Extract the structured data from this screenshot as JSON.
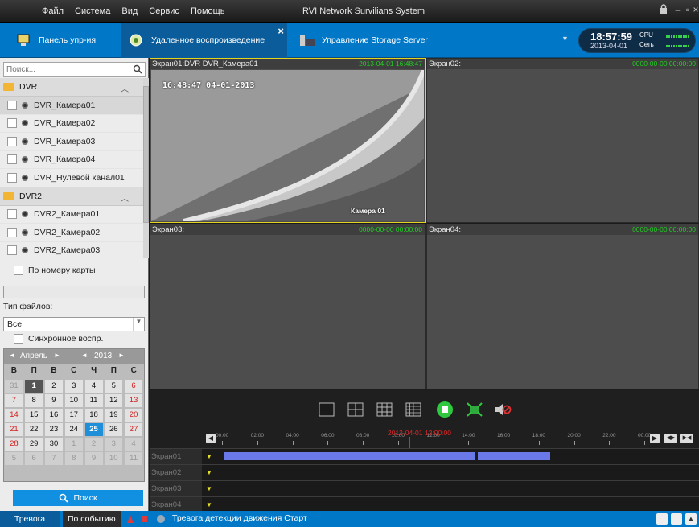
{
  "menu": [
    "Файл",
    "Система",
    "Вид",
    "Сервис",
    "Помощь"
  ],
  "app_title": "RVI Network Survilians System",
  "tabs": [
    {
      "label": "Панель упр-ия",
      "icon": "monitor-icon"
    },
    {
      "label": "Удаленное воспроизведение",
      "icon": "playback-icon",
      "active": true
    },
    {
      "label": "Управление Storage Server",
      "icon": "storage-server-icon"
    }
  ],
  "clock": {
    "time": "18:57:59",
    "date": "2013-04-01",
    "cpu_label": "CPU",
    "net_label": "Сеть"
  },
  "search": {
    "placeholder": "Поиск..."
  },
  "tree": {
    "groups": [
      {
        "name": "DVR",
        "items": [
          "DVR_Камера01",
          "DVR_Камера02",
          "DVR_Камера03",
          "DVR_Камера04",
          "DVR_Нулевой канал01"
        ]
      },
      {
        "name": "DVR2",
        "items": [
          "DVR2_Камера01",
          "DVR2_Камера02",
          "DVR2_Камера03"
        ]
      }
    ]
  },
  "by_card": "По номеру карты",
  "file_type_label": "Тип файлов:",
  "file_type_value": "Все",
  "sync_label": "Синхронное воспр.",
  "calendar": {
    "month_label": "Апрель",
    "year_label": "2013",
    "prev": "◄",
    "next": "►",
    "dow": [
      "В",
      "П",
      "В",
      "С",
      "Ч",
      "П",
      "С"
    ],
    "weeks": [
      [
        "31",
        "1",
        "2",
        "3",
        "4",
        "5",
        "6"
      ],
      [
        "7",
        "8",
        "9",
        "10",
        "11",
        "12",
        "13"
      ],
      [
        "14",
        "15",
        "16",
        "17",
        "18",
        "19",
        "20"
      ],
      [
        "21",
        "22",
        "23",
        "24",
        "25",
        "26",
        "27"
      ],
      [
        "28",
        "29",
        "30",
        "1",
        "2",
        "3",
        "4"
      ],
      [
        "5",
        "6",
        "7",
        "8",
        "9",
        "10",
        "11"
      ]
    ],
    "today": "1",
    "selected": "25"
  },
  "search_button": "Поиск",
  "panes": [
    {
      "title": "Экран01:DVR DVR_Камера01",
      "timestamp": "2013-04-01 16:48:47"
    },
    {
      "title": "Экран02:",
      "timestamp": "0000-00-00 00:00:00"
    },
    {
      "title": "Экран03:",
      "timestamp": "0000-00-00 00:00:00"
    },
    {
      "title": "Экран04:",
      "timestamp": "0000-00-00 00:00:00"
    }
  ],
  "osd": {
    "datetime": "16:48:47 04-01-2013",
    "camera": "Камера 01"
  },
  "timeline": {
    "current": "2013-04-01 12:00:00",
    "hours": [
      "00:00",
      "02:00",
      "04:00",
      "06:00",
      "08:00",
      "10:00",
      "12:00",
      "14:00",
      "16:00",
      "18:00",
      "20:00",
      "22:00",
      "00:00"
    ],
    "rows": [
      "Экран01",
      "Экран02",
      "Экран03",
      "Экран04"
    ]
  },
  "status": {
    "alarm_tab": "Тревога",
    "event_tab": "По событию",
    "message": "Тревога детекции движения Старт"
  },
  "colors": {
    "accent": "#0078c7",
    "record_segment": "#6b79e8",
    "timestamp": "#22cc22",
    "active_border": "#e3d424"
  }
}
